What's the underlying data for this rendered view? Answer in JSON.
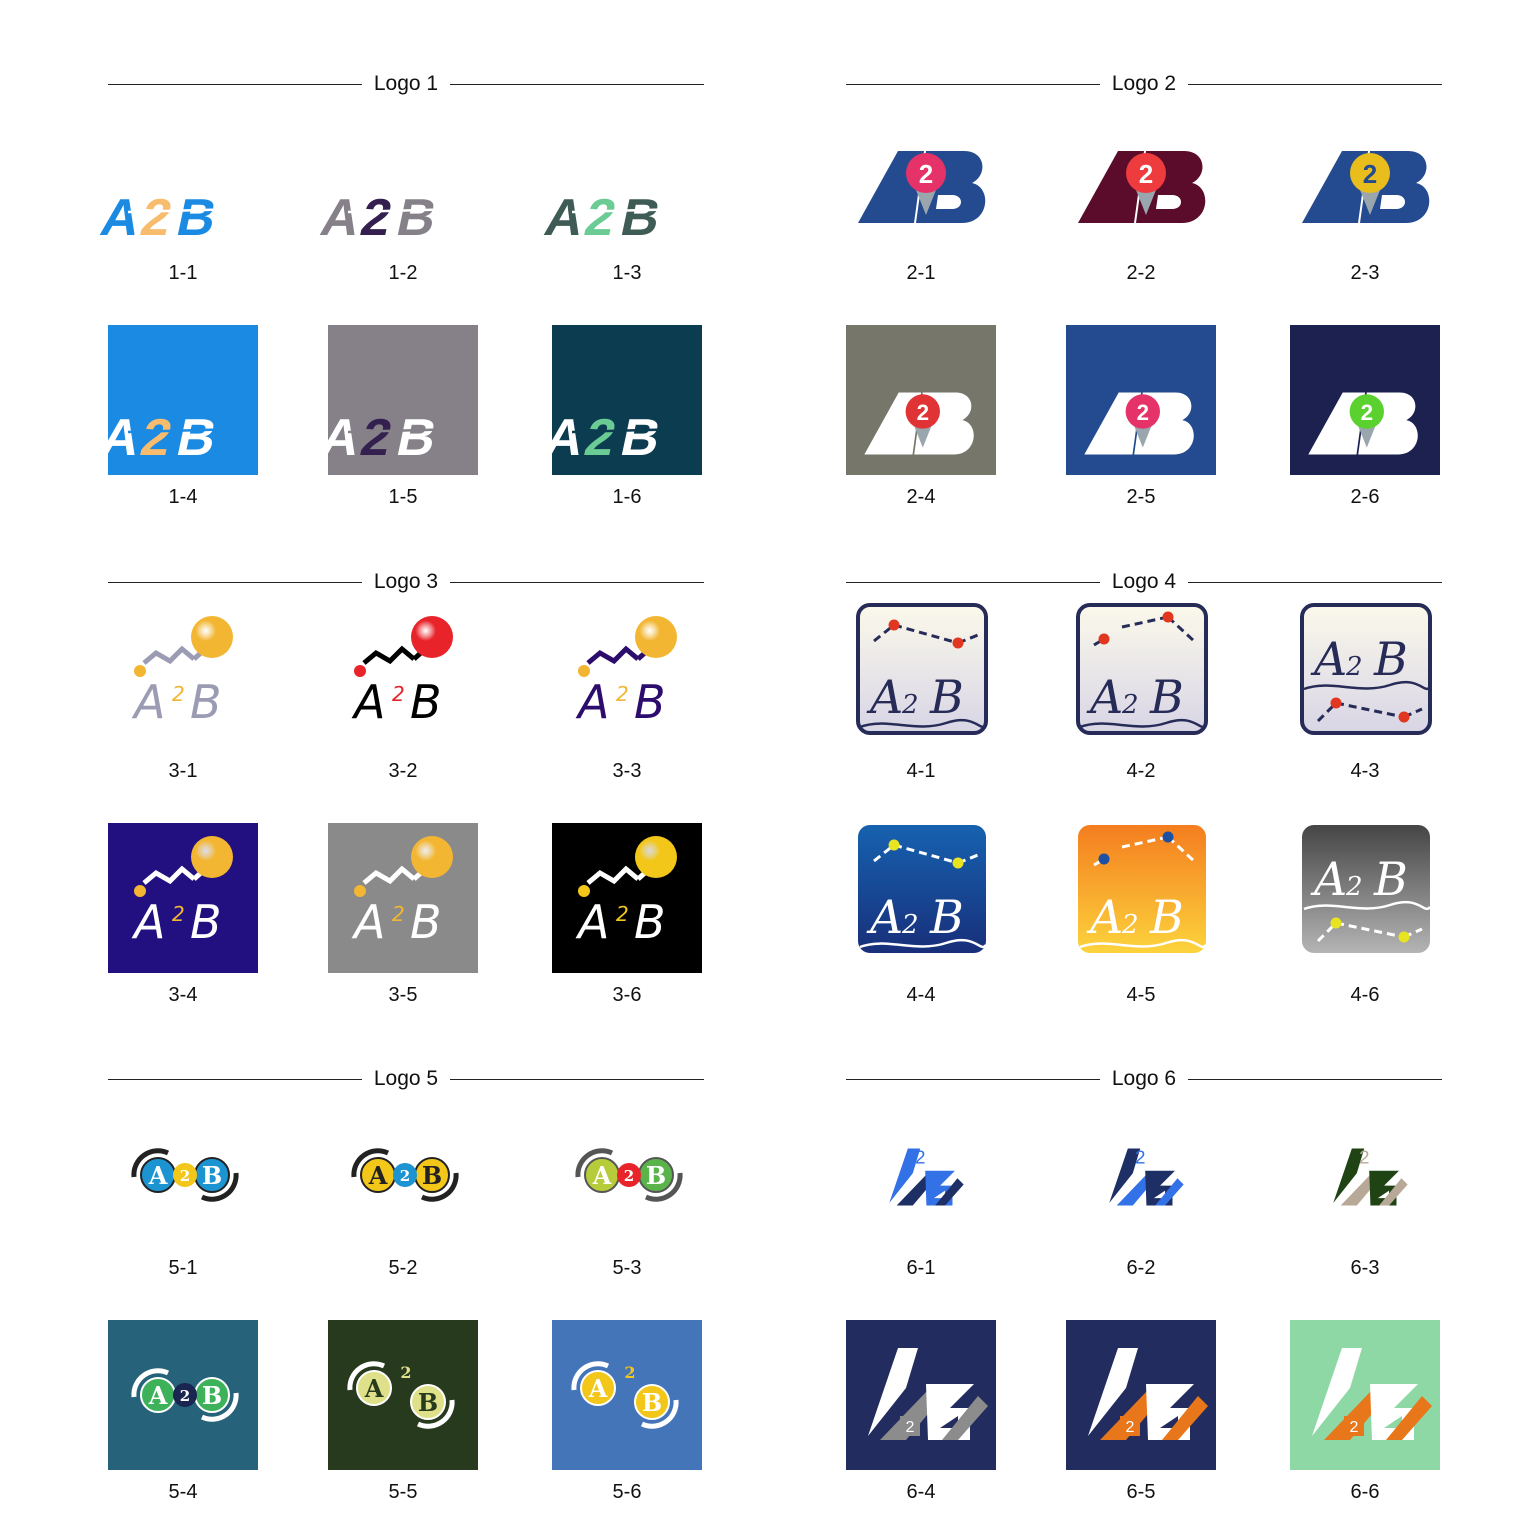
{
  "sections": [
    {
      "title": "Logo 1",
      "items": [
        {
          "caption": "1-1",
          "kind": "logo1",
          "bg": "",
          "colors": {
            "a": "#1b8ae3",
            "two": "#f8bc6f",
            "b": "#1b8ae3"
          }
        },
        {
          "caption": "1-2",
          "kind": "logo1",
          "bg": "",
          "colors": {
            "a": "#868189",
            "two": "#33204f",
            "b": "#868189"
          }
        },
        {
          "caption": "1-3",
          "kind": "logo1",
          "bg": "",
          "colors": {
            "a": "#3f5b55",
            "two": "#6acc94",
            "b": "#3f5b55"
          }
        },
        {
          "caption": "1-4",
          "kind": "logo1",
          "bg": "#1b8ae3",
          "colors": {
            "a": "#ffffff",
            "two": "#f8bc6f",
            "b": "#ffffff"
          }
        },
        {
          "caption": "1-5",
          "kind": "logo1",
          "bg": "#868189",
          "colors": {
            "a": "#ffffff",
            "two": "#33204f",
            "b": "#ffffff"
          }
        },
        {
          "caption": "1-6",
          "kind": "logo1",
          "bg": "#0b3c50",
          "colors": {
            "a": "#ffffff",
            "two": "#6acc94",
            "b": "#ffffff"
          }
        }
      ]
    },
    {
      "title": "Logo 2",
      "items": [
        {
          "caption": "2-1",
          "kind": "logo2",
          "bg": "",
          "colors": {
            "ab": "#244b8f",
            "pin": "#e5336a",
            "pinText": "#ffffff"
          }
        },
        {
          "caption": "2-2",
          "kind": "logo2",
          "bg": "",
          "colors": {
            "ab": "#5a0c2a",
            "pin": "#ee3b3e",
            "pinText": "#ffffff"
          }
        },
        {
          "caption": "2-3",
          "kind": "logo2",
          "bg": "",
          "colors": {
            "ab": "#244b8f",
            "pin": "#e9be1c",
            "pinText": "#244b8f"
          }
        },
        {
          "caption": "2-4",
          "kind": "logo2",
          "bg": "#76766b",
          "colors": {
            "ab": "#ffffff",
            "pin": "#e03336",
            "pinText": "#ffffff"
          }
        },
        {
          "caption": "2-5",
          "kind": "logo2",
          "bg": "#244b8f",
          "colors": {
            "ab": "#ffffff",
            "pin": "#e5336a",
            "pinText": "#ffffff"
          }
        },
        {
          "caption": "2-6",
          "kind": "logo2",
          "bg": "#1c2150",
          "colors": {
            "ab": "#ffffff",
            "pin": "#5bd12f",
            "pinText": "#ffffff"
          }
        }
      ]
    },
    {
      "title": "Logo 3",
      "items": [
        {
          "caption": "3-1",
          "kind": "logo3",
          "bg": "",
          "colors": {
            "text": "#9b9cb4",
            "line": "#9b9cb4",
            "two": "#f2b632",
            "ball": "#f2b632",
            "dot": "#f2b632"
          }
        },
        {
          "caption": "3-2",
          "kind": "logo3",
          "bg": "",
          "colors": {
            "text": "#000000",
            "line": "#000000",
            "two": "#e8232a",
            "ball": "#e8232a",
            "dot": "#e8232a"
          }
        },
        {
          "caption": "3-3",
          "kind": "logo3",
          "bg": "",
          "colors": {
            "text": "#2c0d6d",
            "line": "#2c0d6d",
            "two": "#f2b632",
            "ball": "#f2b632",
            "dot": "#f2b632"
          }
        },
        {
          "caption": "3-4",
          "kind": "logo3",
          "bg": "#221080",
          "colors": {
            "text": "#ffffff",
            "line": "#ffffff",
            "two": "#f2b632",
            "ball": "#f2b632",
            "dot": "#f2b632"
          }
        },
        {
          "caption": "3-5",
          "kind": "logo3",
          "bg": "#8a8a8a",
          "colors": {
            "text": "#ffffff",
            "line": "#ffffff",
            "two": "#f2b632",
            "ball": "#f2b632",
            "dot": "#f2b632"
          }
        },
        {
          "caption": "3-6",
          "kind": "logo3",
          "bg": "#000000",
          "colors": {
            "text": "#ffffff",
            "line": "#ffffff",
            "two": "#f2c71a",
            "ball": "#f2c71a",
            "dot": "#f2c71a"
          }
        }
      ]
    },
    {
      "title": "Logo 4",
      "items": [
        {
          "caption": "4-1",
          "kind": "logo4",
          "bg": "",
          "colors": {
            "frame": "#262b57",
            "top": "#fbf9ea",
            "bottom": "#d8d5e6",
            "text": "#262b57",
            "dash": "#262b57",
            "dot": "#e1361f"
          }
        },
        {
          "caption": "4-2",
          "kind": "logo4",
          "bg": "",
          "colors": {
            "frame": "#262b57",
            "top": "#fbf9ea",
            "bottom": "#d8d5e6",
            "text": "#262b57",
            "dash": "#262b57",
            "dot": "#e1361f"
          }
        },
        {
          "caption": "4-3",
          "kind": "logo4",
          "bg": "",
          "colors": {
            "frame": "#262b57",
            "top": "#fbf9ea",
            "bottom": "#d8d5e6",
            "text": "#262b57",
            "dash": "#262b57",
            "dot": "#e1361f"
          }
        },
        {
          "caption": "4-4",
          "kind": "logo4",
          "bg": "",
          "colors": {
            "frame": "none",
            "top": "#1662b0",
            "bottom": "#182f7a",
            "text": "#ffffff",
            "dash": "#ffffff",
            "dot": "#e8e421"
          }
        },
        {
          "caption": "4-5",
          "kind": "logo4",
          "bg": "",
          "colors": {
            "frame": "none",
            "top": "#f47d1f",
            "bottom": "#fcd33c",
            "text": "#ffffff",
            "dash": "#ffffff",
            "dot": "#1d4fa3"
          }
        },
        {
          "caption": "4-6",
          "kind": "logo4",
          "bg": "",
          "colors": {
            "frame": "none",
            "top": "#454545",
            "bottom": "#b4b4b4",
            "text": "#ffffff",
            "dash": "#ffffff",
            "dot": "#e8e421"
          }
        }
      ]
    },
    {
      "title": "Logo 5",
      "items": [
        {
          "caption": "5-1",
          "kind": "logo5",
          "bg": "",
          "colors": {
            "a": "#1d94d2",
            "b": "#1d94d2",
            "two": "#f2c71a",
            "twoText": "#ffffff",
            "ring": "#222222",
            "letters": "#ffffff"
          }
        },
        {
          "caption": "5-2",
          "kind": "logo5",
          "bg": "",
          "colors": {
            "a": "#f2c71a",
            "b": "#f2c71a",
            "two": "#1d94d2",
            "twoText": "#ffffff",
            "ring": "#222222",
            "letters": "#222222"
          }
        },
        {
          "caption": "5-3",
          "kind": "logo5",
          "bg": "",
          "colors": {
            "a": "#b6cc3b",
            "b": "#5ab44a",
            "two": "#e8232a",
            "twoText": "#ffffff",
            "ring": "#555555",
            "letters": "#ffffff"
          }
        },
        {
          "caption": "5-4",
          "kind": "logo5",
          "bg": "#26627a",
          "colors": {
            "a": "#3db25a",
            "b": "#3db25a",
            "two": "#1b2552",
            "twoText": "#ffffff",
            "ring": "#ffffff",
            "letters": "#ffffff"
          }
        },
        {
          "caption": "5-5",
          "kind": "logo5",
          "bg": "#273a1d",
          "colors": {
            "a": "#dfe18a",
            "b": "#dfe18a",
            "two": "none",
            "twoText": "#dfe18a",
            "ring": "#ffffff",
            "letters": "#273a1d"
          }
        },
        {
          "caption": "5-6",
          "kind": "logo5",
          "bg": "#4575b9",
          "colors": {
            "a": "#f2c71a",
            "b": "#f2c71a",
            "two": "none",
            "twoText": "#f2c71a",
            "ring": "#ffffff",
            "letters": "#ffffff"
          }
        }
      ]
    },
    {
      "title": "Logo 6",
      "items": [
        {
          "caption": "6-1",
          "kind": "logo6",
          "bg": "",
          "colors": {
            "a": "#3271e6",
            "slash": "#1e2f65",
            "b": "#3271e6",
            "two": "#3271e6",
            "box": "none"
          }
        },
        {
          "caption": "6-2",
          "kind": "logo6",
          "bg": "",
          "colors": {
            "a": "#1e2f65",
            "slash": "#3271e6",
            "b": "#1e2f65",
            "two": "#3271e6",
            "box": "none"
          }
        },
        {
          "caption": "6-3",
          "kind": "logo6",
          "bg": "",
          "colors": {
            "a": "#204314",
            "slash": "#b8a897",
            "b": "#204314",
            "two": "#b8a897",
            "box": "none"
          }
        },
        {
          "caption": "6-4",
          "kind": "logo6",
          "bg": "#222c5e",
          "colors": {
            "a": "#ffffff",
            "slash": "#8c8c8c",
            "b": "#ffffff",
            "two": "#ffffff",
            "box": "#8c8c8c"
          }
        },
        {
          "caption": "6-5",
          "kind": "logo6",
          "bg": "#222c5e",
          "colors": {
            "a": "#ffffff",
            "slash": "#e8761a",
            "b": "#ffffff",
            "two": "#ffffff",
            "box": "#e8761a"
          }
        },
        {
          "caption": "6-6",
          "kind": "logo6",
          "bg": "#8ed8a5",
          "colors": {
            "a": "#ffffff",
            "slash": "#e8761a",
            "b": "#ffffff",
            "two": "#ffffff",
            "box": "#e8761a"
          }
        }
      ]
    }
  ],
  "logo_text": {
    "a": "A",
    "two": "2",
    "b": "B"
  }
}
